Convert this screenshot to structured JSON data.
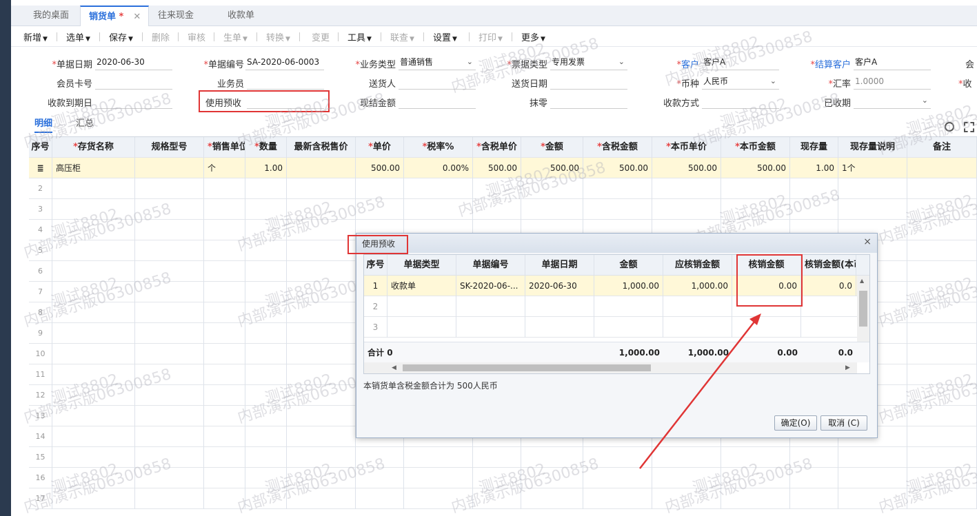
{
  "tabs": [
    "我的桌面",
    "销货单",
    "往来现金",
    "收款单"
  ],
  "active_tab_star": "*",
  "tab_close": "✕",
  "toolbar": [
    {
      "label": "新增",
      "dd": true,
      "disabled": false
    },
    {
      "label": "选单",
      "dd": true,
      "disabled": false
    },
    {
      "label": "保存",
      "dd": true,
      "disabled": false
    },
    {
      "label": "删除",
      "dd": false,
      "disabled": true
    },
    {
      "label": "审核",
      "dd": false,
      "disabled": true
    },
    {
      "label": "生单",
      "dd": true,
      "disabled": true
    },
    {
      "label": "转换",
      "dd": true,
      "disabled": true
    },
    {
      "label": "变更",
      "dd": false,
      "disabled": true
    },
    {
      "label": "工具",
      "dd": true,
      "disabled": false
    },
    {
      "label": "联查",
      "dd": true,
      "disabled": true
    },
    {
      "label": "设置",
      "dd": true,
      "disabled": false
    },
    {
      "label": "打印",
      "dd": true,
      "disabled": true
    },
    {
      "label": "更多",
      "dd": true,
      "disabled": false
    }
  ],
  "form": {
    "date_label": "单据日期",
    "date_value": "2020-06-30",
    "code_label": "单据编号",
    "code_value": "SA-2020-06-0003",
    "biz_label": "业务类型",
    "biz_value": "普通销售",
    "invoice_label": "票据类型",
    "invoice_value": "专用发票",
    "customer_label": "客户",
    "customer_value": "客户A",
    "settle_label": "结算客户",
    "settle_value": "客户A",
    "member_cut": "会",
    "card_label": "会员卡号",
    "card_value": "",
    "salesman_label": "业务员",
    "salesman_value": "",
    "deliver_label": "送货人",
    "deliver_value": "",
    "deliver_date_label": "送货日期",
    "deliver_date_value": "",
    "currency_label": "币种",
    "currency_value": "人民币",
    "rate_label": "汇率",
    "rate_value": "1.0000",
    "receive_cut": "收",
    "due_label": "收款到期日",
    "due_value": "",
    "prepay_label": "使用预收",
    "prepay_value": "",
    "cash_label": "现结金额",
    "cash_value": "",
    "round_label": "抹零",
    "round_value": "",
    "method_label": "收款方式",
    "method_value": "",
    "received_label": "已收期",
    "received_value": ""
  },
  "subtabs": [
    "明细",
    "汇总"
  ],
  "grid": {
    "headers": [
      "序号",
      "存货名称",
      "规格型号",
      "销售单位",
      "数量",
      "最新含税售价",
      "单价",
      "税率%",
      "含税单价",
      "金额",
      "含税金额",
      "本币单价",
      "本币金额",
      "现存量",
      "现存量说明",
      "备注"
    ],
    "row": [
      "高压柜",
      "",
      "个",
      "1.00",
      "",
      "500.00",
      "0.00%",
      "500.00",
      "500.00",
      "500.00",
      "500.00",
      "500.00",
      "1.00",
      "1个",
      ""
    ],
    "row_numbers": [
      "2",
      "3",
      "4",
      "5",
      "6",
      "7",
      "8",
      "9",
      "10",
      "11",
      "12",
      "13",
      "14",
      "15",
      "16",
      "17"
    ]
  },
  "dialog": {
    "title": "使用预收",
    "close": "×",
    "headers": [
      "序号",
      "单据类型",
      "单据编号",
      "单据日期",
      "金额",
      "应核销金额",
      "核销金额",
      "核销金额(本币"
    ],
    "row": [
      "1",
      "收款单",
      "SK-2020-06-...",
      "2020-06-30",
      "1,000.00",
      "1,000.00",
      "0.00",
      "0.0"
    ],
    "row_numbers": [
      "2",
      "3"
    ],
    "total_label": "合计",
    "total_count": "0",
    "totals": [
      "1,000.00",
      "1,000.00",
      "0.00",
      "0.0"
    ],
    "note": "本销货单含税金额合计为 500人民币",
    "ok": "确定(O)",
    "cancel": "取消 (C)"
  },
  "watermarks": [
    "测试8802",
    "内部演示版06300858"
  ],
  "colors": {
    "accent": "#2a6fdb",
    "annotation": "#e03535",
    "selected_row": "#fff8d8"
  }
}
